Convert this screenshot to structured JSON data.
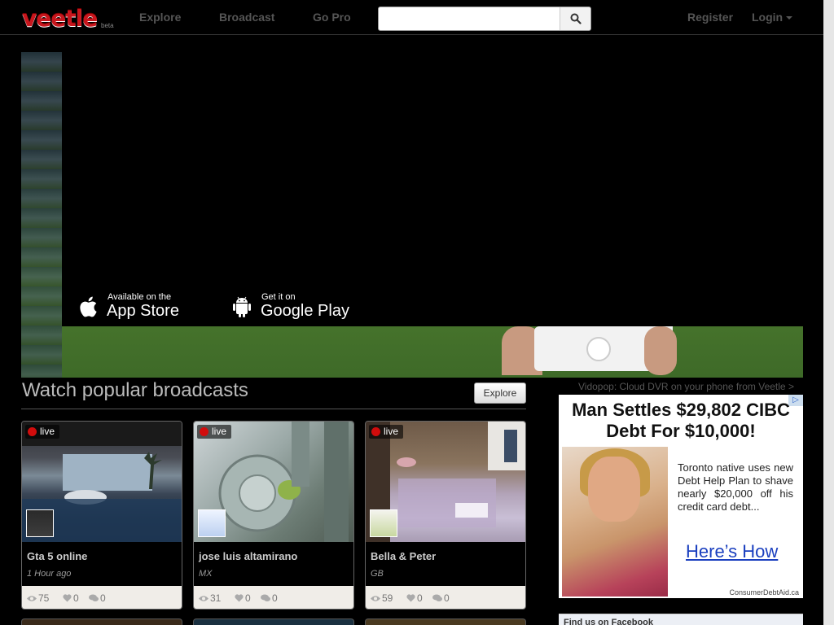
{
  "header": {
    "logo": "veetle",
    "logo_tag": "beta",
    "nav": [
      "Explore",
      "Broadcast",
      "Go Pro"
    ],
    "search": {
      "value": "",
      "placeholder": ""
    },
    "register": "Register",
    "login": "Login"
  },
  "hero": {
    "app_store": {
      "small": "Available on the",
      "big": "App Store"
    },
    "google_play": {
      "small": "Get it on",
      "big": "Google Play"
    }
  },
  "popular": {
    "title": "Watch popular broadcasts",
    "explore_label": "Explore",
    "live_label": "live",
    "cards": [
      {
        "title": "Gta 5 online",
        "sub": "1 Hour ago",
        "views": "75",
        "likes": "0",
        "comments": "0"
      },
      {
        "title": "jose luis altamirano",
        "sub": "MX",
        "views": "31",
        "likes": "0",
        "comments": "0"
      },
      {
        "title": "Bella & Peter",
        "sub": "GB",
        "views": "59",
        "likes": "0",
        "comments": "0"
      }
    ]
  },
  "sidebar": {
    "promo": "Vidopop: Cloud DVR on your phone from Veetle >",
    "ad": {
      "headline": "Man Settles $29,802 CIBC Debt For $10,000!",
      "body": "Toronto native uses new Debt Help Plan to shave nearly $20,000 off his credit card debt...",
      "cta": "Here’s How",
      "source": "ConsumerDebtAid.ca"
    },
    "facebook_title": "Find us on Facebook"
  },
  "colors": {
    "brand": "#c8161d",
    "live_dot": "#d10c0c",
    "ad_link": "#1a3fbf"
  }
}
